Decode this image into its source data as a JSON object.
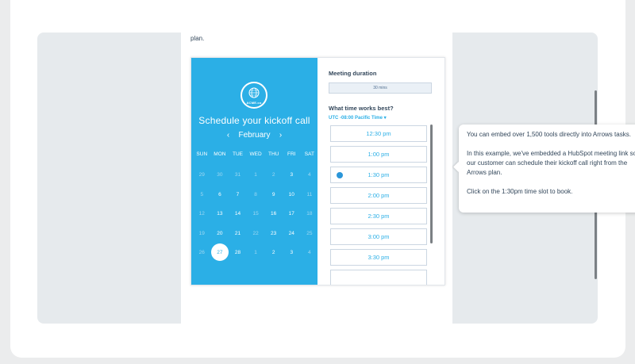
{
  "page": {
    "doc_text": "plan."
  },
  "calendar": {
    "logo_text": "ACME.co",
    "title": "Schedule your kickoff call",
    "month": "February",
    "prev_arrow": "‹",
    "next_arrow": "›",
    "weekdays": [
      "SUN",
      "MON",
      "TUE",
      "WED",
      "THU",
      "FRI",
      "SAT"
    ],
    "days": [
      {
        "d": "29",
        "muted": true
      },
      {
        "d": "30",
        "muted": true
      },
      {
        "d": "31",
        "muted": true
      },
      {
        "d": "1",
        "muted": true
      },
      {
        "d": "2",
        "muted": true
      },
      {
        "d": "3",
        "muted": false
      },
      {
        "d": "4",
        "muted": true
      },
      {
        "d": "5",
        "muted": true
      },
      {
        "d": "6",
        "muted": false
      },
      {
        "d": "7",
        "muted": false
      },
      {
        "d": "8",
        "muted": true
      },
      {
        "d": "9",
        "muted": false
      },
      {
        "d": "10",
        "muted": false
      },
      {
        "d": "11",
        "muted": true
      },
      {
        "d": "12",
        "muted": true
      },
      {
        "d": "13",
        "muted": false
      },
      {
        "d": "14",
        "muted": false
      },
      {
        "d": "15",
        "muted": true
      },
      {
        "d": "16",
        "muted": false
      },
      {
        "d": "17",
        "muted": false
      },
      {
        "d": "18",
        "muted": true
      },
      {
        "d": "19",
        "muted": true
      },
      {
        "d": "20",
        "muted": false
      },
      {
        "d": "21",
        "muted": false
      },
      {
        "d": "22",
        "muted": true
      },
      {
        "d": "23",
        "muted": false
      },
      {
        "d": "24",
        "muted": false
      },
      {
        "d": "25",
        "muted": true
      },
      {
        "d": "26",
        "muted": true
      },
      {
        "d": "27",
        "muted": false,
        "selected": true
      },
      {
        "d": "28",
        "muted": false
      },
      {
        "d": "1",
        "muted": true
      },
      {
        "d": "2",
        "muted": false
      },
      {
        "d": "3",
        "muted": false
      },
      {
        "d": "4",
        "muted": true
      }
    ]
  },
  "meeting": {
    "duration_label": "Meeting duration",
    "duration_value": "30 mins",
    "time_label": "What time works best?",
    "timezone": "UTC -08:00 Pacific Time ▾",
    "slots": [
      "12:30 pm",
      "1:00 pm",
      "1:30 pm",
      "2:00 pm",
      "2:30 pm",
      "3:00 pm",
      "3:30 pm",
      ""
    ]
  },
  "tooltip": {
    "p1": "You can embed over 1,500 tools directly into Arrows tasks.",
    "p2": "In this example, we've embedded a HubSpot meeting link so our customer can schedule their kickoff call right from the Arrows plan.",
    "p3": "Click on the 1:30pm time slot to book."
  },
  "colors": {
    "accent": "#2bafe6",
    "slot_dot": "#2b96d9"
  }
}
